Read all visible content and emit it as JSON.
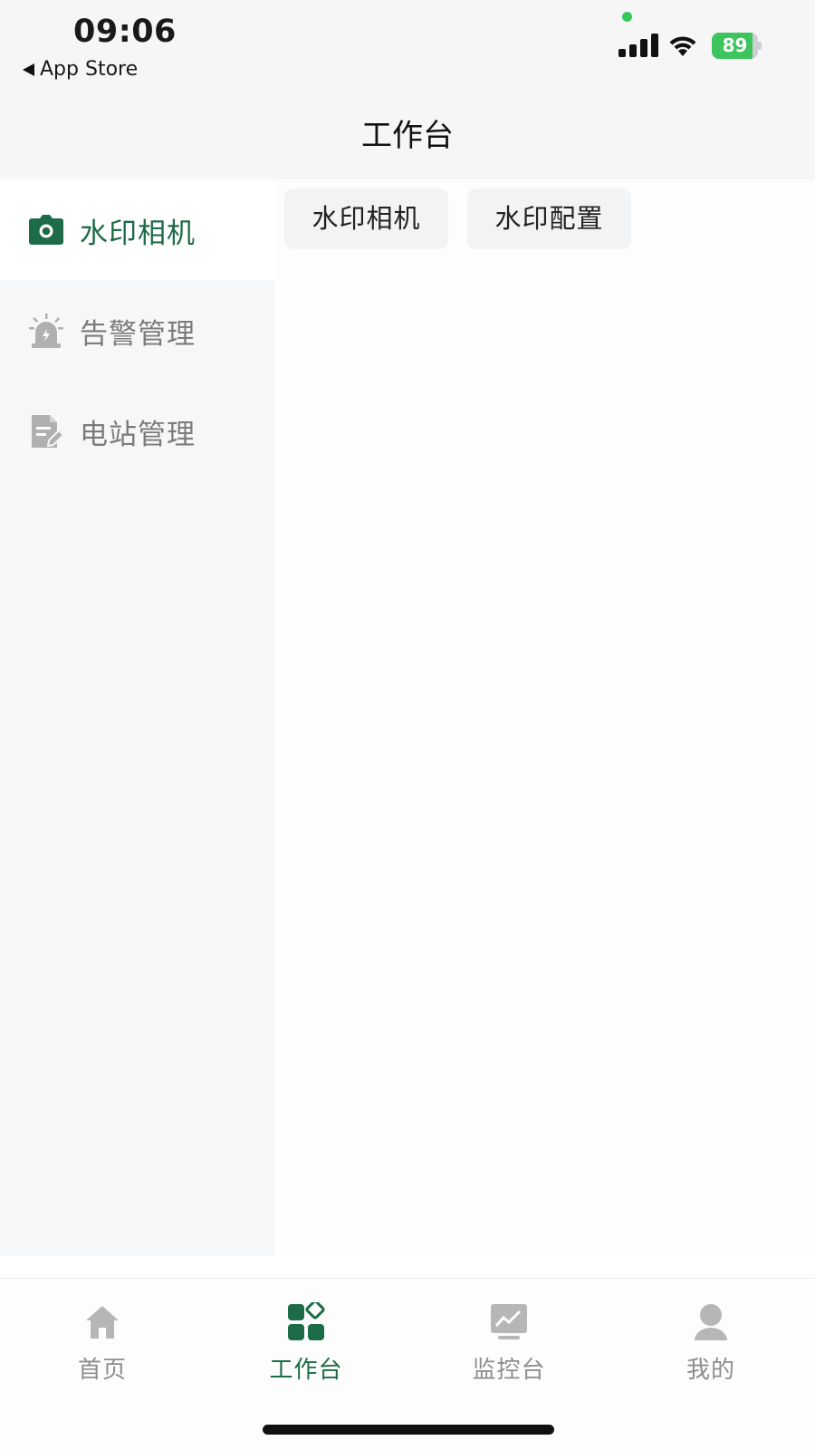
{
  "status_bar": {
    "time": "09:06",
    "back_label": "App Store",
    "battery_percent": "89",
    "battery_level": 0.89,
    "colors": {
      "battery_fill": "#3cc55c",
      "privacy_dot": "#35c759"
    }
  },
  "header": {
    "title": "工作台"
  },
  "sidebar": {
    "items": [
      {
        "label": "水印相机",
        "icon": "camera-icon",
        "active": true
      },
      {
        "label": "告警管理",
        "icon": "alarm-siren-icon",
        "active": false
      },
      {
        "label": "电站管理",
        "icon": "document-edit-icon",
        "active": false
      }
    ]
  },
  "content": {
    "chips": [
      {
        "label": "水印相机"
      },
      {
        "label": "水印配置"
      }
    ]
  },
  "tabbar": {
    "tabs": [
      {
        "label": "首页",
        "icon": "home-icon",
        "active": false
      },
      {
        "label": "工作台",
        "icon": "grid-apps-icon",
        "active": true
      },
      {
        "label": "监控台",
        "icon": "monitor-chart-icon",
        "active": false
      },
      {
        "label": "我的",
        "icon": "user-icon",
        "active": false
      }
    ]
  },
  "colors": {
    "accent": "#1d6b47",
    "inactive": "#8d8d8d",
    "sidebar_bg": "#f6f7f9",
    "chip_bg": "#f2f3f5"
  }
}
